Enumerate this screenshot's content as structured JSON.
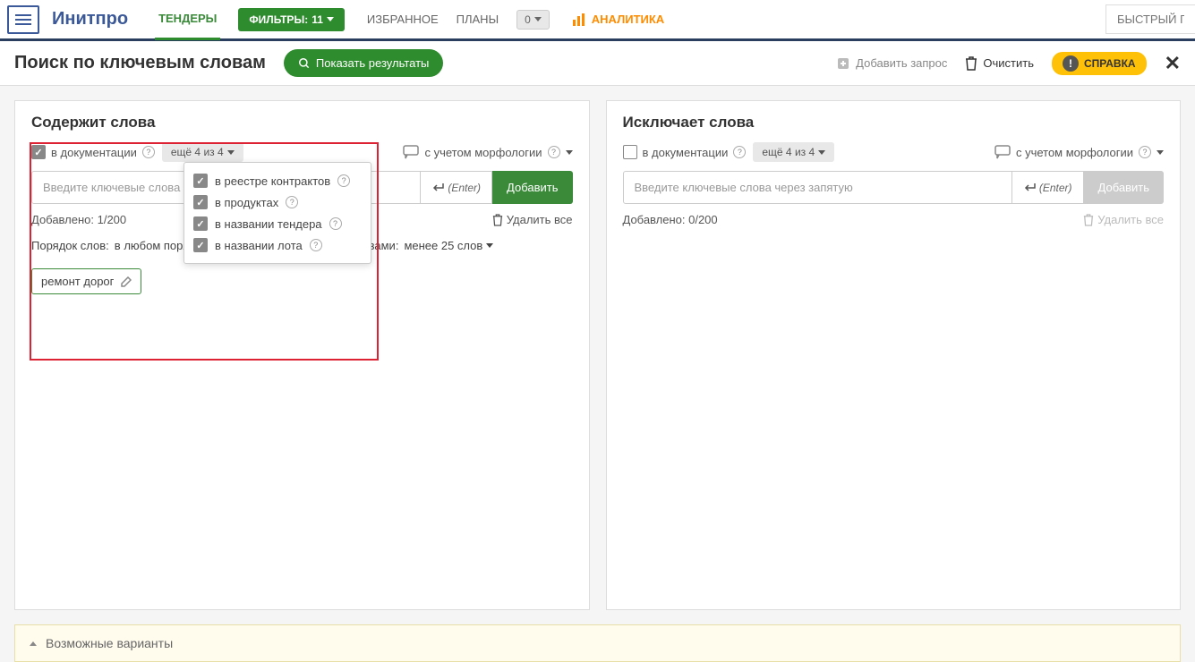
{
  "brand": "Инитпро",
  "nav": {
    "tenders": "ТЕНДЕРЫ",
    "filters_label": "ФИЛЬТРЫ:",
    "filters_count": "11",
    "favorites": "ИЗБРАННОЕ",
    "plans": "ПЛАНЫ",
    "plans_count": "0",
    "analytics": "АНАЛИТИКА",
    "quick_search_placeholder": "БЫСТРЫЙ ПОИ"
  },
  "page": {
    "title": "Поиск по ключевым словам",
    "show_results": "Показать результаты",
    "add_query": "Добавить запрос",
    "clear": "Очистить",
    "help": "СПРАВКА"
  },
  "left_panel": {
    "title": "Содержит слова",
    "in_docs": "в документации",
    "more_badge": "ещё 4 из 4",
    "morphology": "с учетом морфологии",
    "input_placeholder": "Введите ключевые слова",
    "enter_hint": "(Enter)",
    "add_btn": "Добавить",
    "added_label": "Добавлено: 1/200",
    "delete_all": "Удалить все",
    "word_order_label": "Порядок слов:",
    "word_order_value": "в любом порядке",
    "distance_label": "Расстояние между словами:",
    "distance_value": "менее 25 слов",
    "tag": "ремонт дорог",
    "dropdown": {
      "item1": "в реестре контрактов",
      "item2": "в продуктах",
      "item3": "в названии тендера",
      "item4": "в названии лота"
    }
  },
  "right_panel": {
    "title": "Исключает слова",
    "in_docs": "в документации",
    "more_badge": "ещё 4 из 4",
    "morphology": "с учетом морфологии",
    "input_placeholder": "Введите ключевые слова через запятую",
    "enter_hint": "(Enter)",
    "add_btn": "Добавить",
    "added_label": "Добавлено: 0/200",
    "delete_all": "Удалить все"
  },
  "bottom": {
    "variants": "Возможные варианты"
  }
}
